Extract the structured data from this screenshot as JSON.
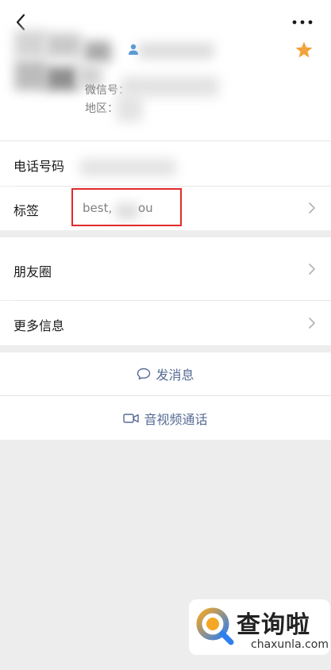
{
  "profile": {
    "wechat_id_label": "微信号：",
    "region_label": "地区："
  },
  "rows": {
    "phone_label": "电话号码",
    "tags_label": "标签",
    "tags_value_prefix": "best,",
    "tags_value_suffix": "ou",
    "moments_label": "朋友圈",
    "more_info_label": "更多信息"
  },
  "actions": {
    "send_message_label": "发消息",
    "av_call_label": "音视频通话"
  },
  "icons": {
    "back": "chevron-left-icon",
    "more": "ellipsis-icon",
    "star": "star-icon",
    "person": "person-icon",
    "chat_bubble": "chat-bubble-icon",
    "video": "video-camera-icon"
  },
  "watermark": {
    "brand_cn": "查询啦",
    "brand_en": "chaxunla.com"
  },
  "colors": {
    "link_blue": "#576b95",
    "star_orange": "#f1a33c",
    "highlight_red": "#e02b2b",
    "background_gray": "#ededed"
  }
}
